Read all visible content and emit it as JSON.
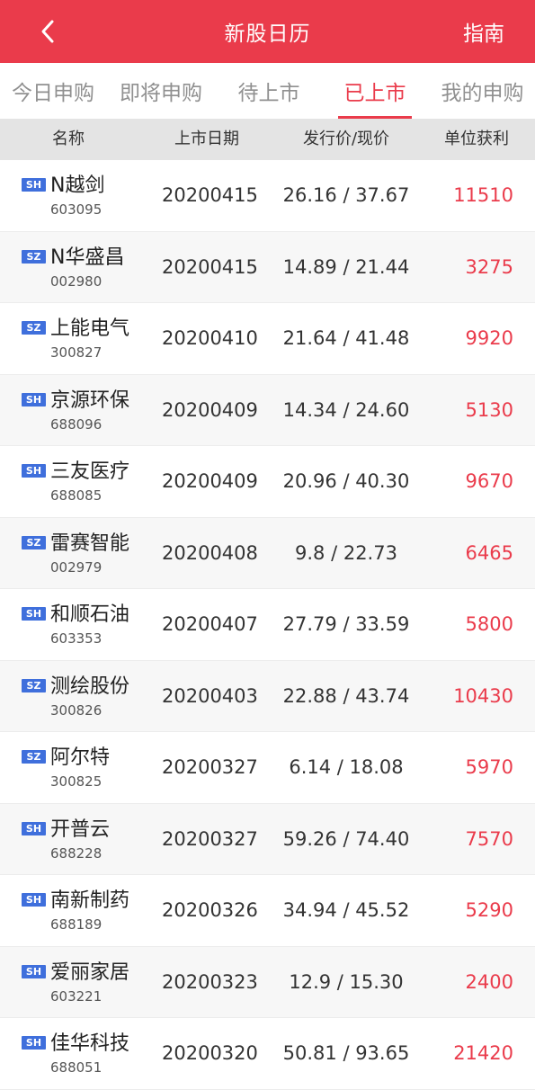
{
  "header": {
    "title": "新股日历",
    "guide_label": "指南"
  },
  "tabs": [
    {
      "label": "今日申购",
      "active": false
    },
    {
      "label": "即将申购",
      "active": false
    },
    {
      "label": "待上市",
      "active": false
    },
    {
      "label": "已上市",
      "active": true
    },
    {
      "label": "我的申购",
      "active": false
    }
  ],
  "columns": {
    "name": "名称",
    "date": "上市日期",
    "price": "发行价/现价",
    "profit": "单位获利"
  },
  "colors": {
    "brand_red": "#ea3b4b",
    "badge_blue": "#3f6fdc"
  },
  "stocks": [
    {
      "market": "SH",
      "name": "N越剑",
      "code": "603095",
      "date": "20200415",
      "price": "26.16 / 37.67",
      "profit": "11510"
    },
    {
      "market": "SZ",
      "name": "N华盛昌",
      "code": "002980",
      "date": "20200415",
      "price": "14.89 / 21.44",
      "profit": "3275"
    },
    {
      "market": "SZ",
      "name": "上能电气",
      "code": "300827",
      "date": "20200410",
      "price": "21.64 / 41.48",
      "profit": "9920"
    },
    {
      "market": "SH",
      "name": "京源环保",
      "code": "688096",
      "date": "20200409",
      "price": "14.34 / 24.60",
      "profit": "5130"
    },
    {
      "market": "SH",
      "name": "三友医疗",
      "code": "688085",
      "date": "20200409",
      "price": "20.96 / 40.30",
      "profit": "9670"
    },
    {
      "market": "SZ",
      "name": "雷赛智能",
      "code": "002979",
      "date": "20200408",
      "price": "9.8 / 22.73",
      "profit": "6465"
    },
    {
      "market": "SH",
      "name": "和顺石油",
      "code": "603353",
      "date": "20200407",
      "price": "27.79 / 33.59",
      "profit": "5800"
    },
    {
      "market": "SZ",
      "name": "测绘股份",
      "code": "300826",
      "date": "20200403",
      "price": "22.88 / 43.74",
      "profit": "10430"
    },
    {
      "market": "SZ",
      "name": "阿尔特",
      "code": "300825",
      "date": "20200327",
      "price": "6.14 / 18.08",
      "profit": "5970"
    },
    {
      "market": "SH",
      "name": "开普云",
      "code": "688228",
      "date": "20200327",
      "price": "59.26 / 74.40",
      "profit": "7570"
    },
    {
      "market": "SH",
      "name": "南新制药",
      "code": "688189",
      "date": "20200326",
      "price": "34.94 / 45.52",
      "profit": "5290"
    },
    {
      "market": "SH",
      "name": "爱丽家居",
      "code": "603221",
      "date": "20200323",
      "price": "12.9 / 15.30",
      "profit": "2400"
    },
    {
      "market": "SH",
      "name": "佳华科技",
      "code": "688051",
      "date": "20200320",
      "price": "50.81 / 93.65",
      "profit": "21420"
    }
  ]
}
